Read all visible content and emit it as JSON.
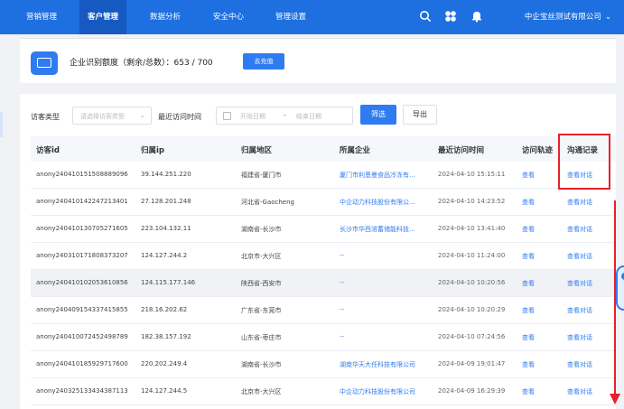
{
  "nav": {
    "items": [
      {
        "label": "营销管理",
        "active": false
      },
      {
        "label": "客户管理",
        "active": true
      },
      {
        "label": "数据分析",
        "active": false
      },
      {
        "label": "安全中心",
        "active": false
      },
      {
        "label": "管理设置",
        "active": false
      }
    ],
    "icons": [
      "search-icon",
      "clover-icon",
      "bell-icon"
    ],
    "company": "中企宝丝测试有限公司",
    "colors": {
      "bar": "#1e6fe0",
      "active": "#1659c0"
    }
  },
  "quota": {
    "text": "企业识别额度（剩余/总数）：653 / 700",
    "button": "去充值"
  },
  "filters": {
    "visitor_type_label": "访客类型",
    "visitor_type_placeholder": "请选择访客类型",
    "last_visit_label": "最近访问时间",
    "start_placeholder": "开始日期",
    "separator": "-",
    "end_placeholder": "结束日期",
    "filter_button": "筛选",
    "export_button": "导出"
  },
  "table": {
    "headers": [
      "访客id",
      "归属ip",
      "归属地区",
      "所属企业",
      "最近访问时间",
      "访问轨迹",
      "沟通记录"
    ],
    "rows": [
      {
        "id": "anony240410151508889096",
        "ip": "39.144.251.220",
        "region": "福建省-厦门市",
        "company": "厦门市利恩曼食品冷冻有...",
        "time": "2024-04-10 15:15:11",
        "track": "查看",
        "chat": "查看对话"
      },
      {
        "id": "anony240410142247213401",
        "ip": "27.128.201.248",
        "region": "河北省-Gaocheng",
        "company": "中企动力科技股份有限公...",
        "time": "2024-04-10 14:23:52",
        "track": "查看",
        "chat": "查看对话"
      },
      {
        "id": "anony240410130705271605",
        "ip": "223.104.132.11",
        "region": "湖南省-长沙市",
        "company": "长沙市华西溶蓄储能科技...",
        "time": "2024-04-10 13:41:40",
        "track": "查看",
        "chat": "查看对话"
      },
      {
        "id": "anony240310171808373207",
        "ip": "124.127.244.2",
        "region": "北京市-大兴区",
        "company": "--",
        "time": "2024-04-10 11:24:00",
        "track": "查看",
        "chat": "查看对话"
      },
      {
        "id": "anony240410102053610856",
        "ip": "124.115.177.146",
        "region": "陕西省-西安市",
        "company": "--",
        "time": "2024-04-10 10:20:56",
        "track": "查看",
        "chat": "查看对话"
      },
      {
        "id": "anony240409154337415855",
        "ip": "218.16.202.62",
        "region": "广东省-东莞市",
        "company": "--",
        "time": "2024-04-10 10:20:29",
        "track": "查看",
        "chat": "查看对话"
      },
      {
        "id": "anony240410072452498789",
        "ip": "182.38.157.192",
        "region": "山东省-枣庄市",
        "company": "--",
        "time": "2024-04-10 07:24:56",
        "track": "查看",
        "chat": "查看对话"
      },
      {
        "id": "anony240410185929717600",
        "ip": "220.202.249.4",
        "region": "湖南省-长沙市",
        "company": "湖南华天大任科技有限公司",
        "time": "2024-04-09 19:01:47",
        "track": "查看",
        "chat": "查看对话"
      },
      {
        "id": "anony240325133434387113",
        "ip": "124.127.244.5",
        "region": "北京市-大兴区",
        "company": "中企动力科技股份有限公司",
        "time": "2024-04-09 16:29:39",
        "track": "查看",
        "chat": "查看对话"
      }
    ]
  },
  "annotation_color": "#e8202a"
}
